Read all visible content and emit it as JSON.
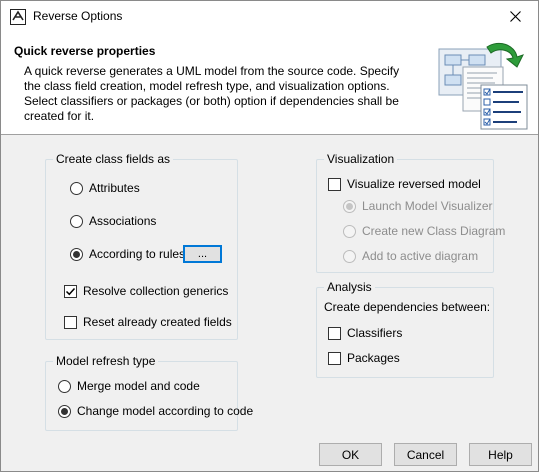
{
  "window": {
    "title": "Reverse Options",
    "close_icon": "close-icon"
  },
  "header": {
    "title": "Quick reverse properties",
    "description": "A quick reverse generates a UML model from the source code. Specify the class field creation, model refresh type, and visualization options. Select classifiers or packages (or both) option if dependencies shall be created for it."
  },
  "class_fields": {
    "legend": "Create class fields as",
    "options": [
      {
        "label": "Attributes",
        "checked": false
      },
      {
        "label": "Associations",
        "checked": false
      },
      {
        "label": "According to rules",
        "checked": true
      }
    ],
    "rules_button": "...",
    "resolve_generics": {
      "label": "Resolve collection generics",
      "checked": true
    },
    "reset_fields": {
      "label": "Reset already created fields",
      "checked": false
    }
  },
  "model_refresh": {
    "legend": "Model refresh type",
    "options": [
      {
        "label": "Merge model and code",
        "checked": false
      },
      {
        "label": "Change model according to code",
        "checked": true
      }
    ]
  },
  "visualization": {
    "legend": "Visualization",
    "visualize": {
      "label": "Visualize reversed model",
      "checked": false
    },
    "options": [
      {
        "label": "Launch Model Visualizer",
        "checked": true,
        "disabled": true
      },
      {
        "label": "Create new Class Diagram",
        "checked": false,
        "disabled": true
      },
      {
        "label": "Add to active diagram",
        "checked": false,
        "disabled": true
      }
    ]
  },
  "analysis": {
    "legend": "Analysis",
    "prompt": "Create dependencies between:",
    "classifiers": {
      "label": "Classifiers",
      "checked": false
    },
    "packages": {
      "label": "Packages",
      "checked": false
    }
  },
  "buttons": {
    "ok": "OK",
    "cancel": "Cancel",
    "help": "Help"
  },
  "colors": {
    "header_bg": "#ffffff",
    "dialog_bg": "#f0f0f0",
    "focus_accent": "#0078d7",
    "group_border": "#d5dfe5"
  }
}
